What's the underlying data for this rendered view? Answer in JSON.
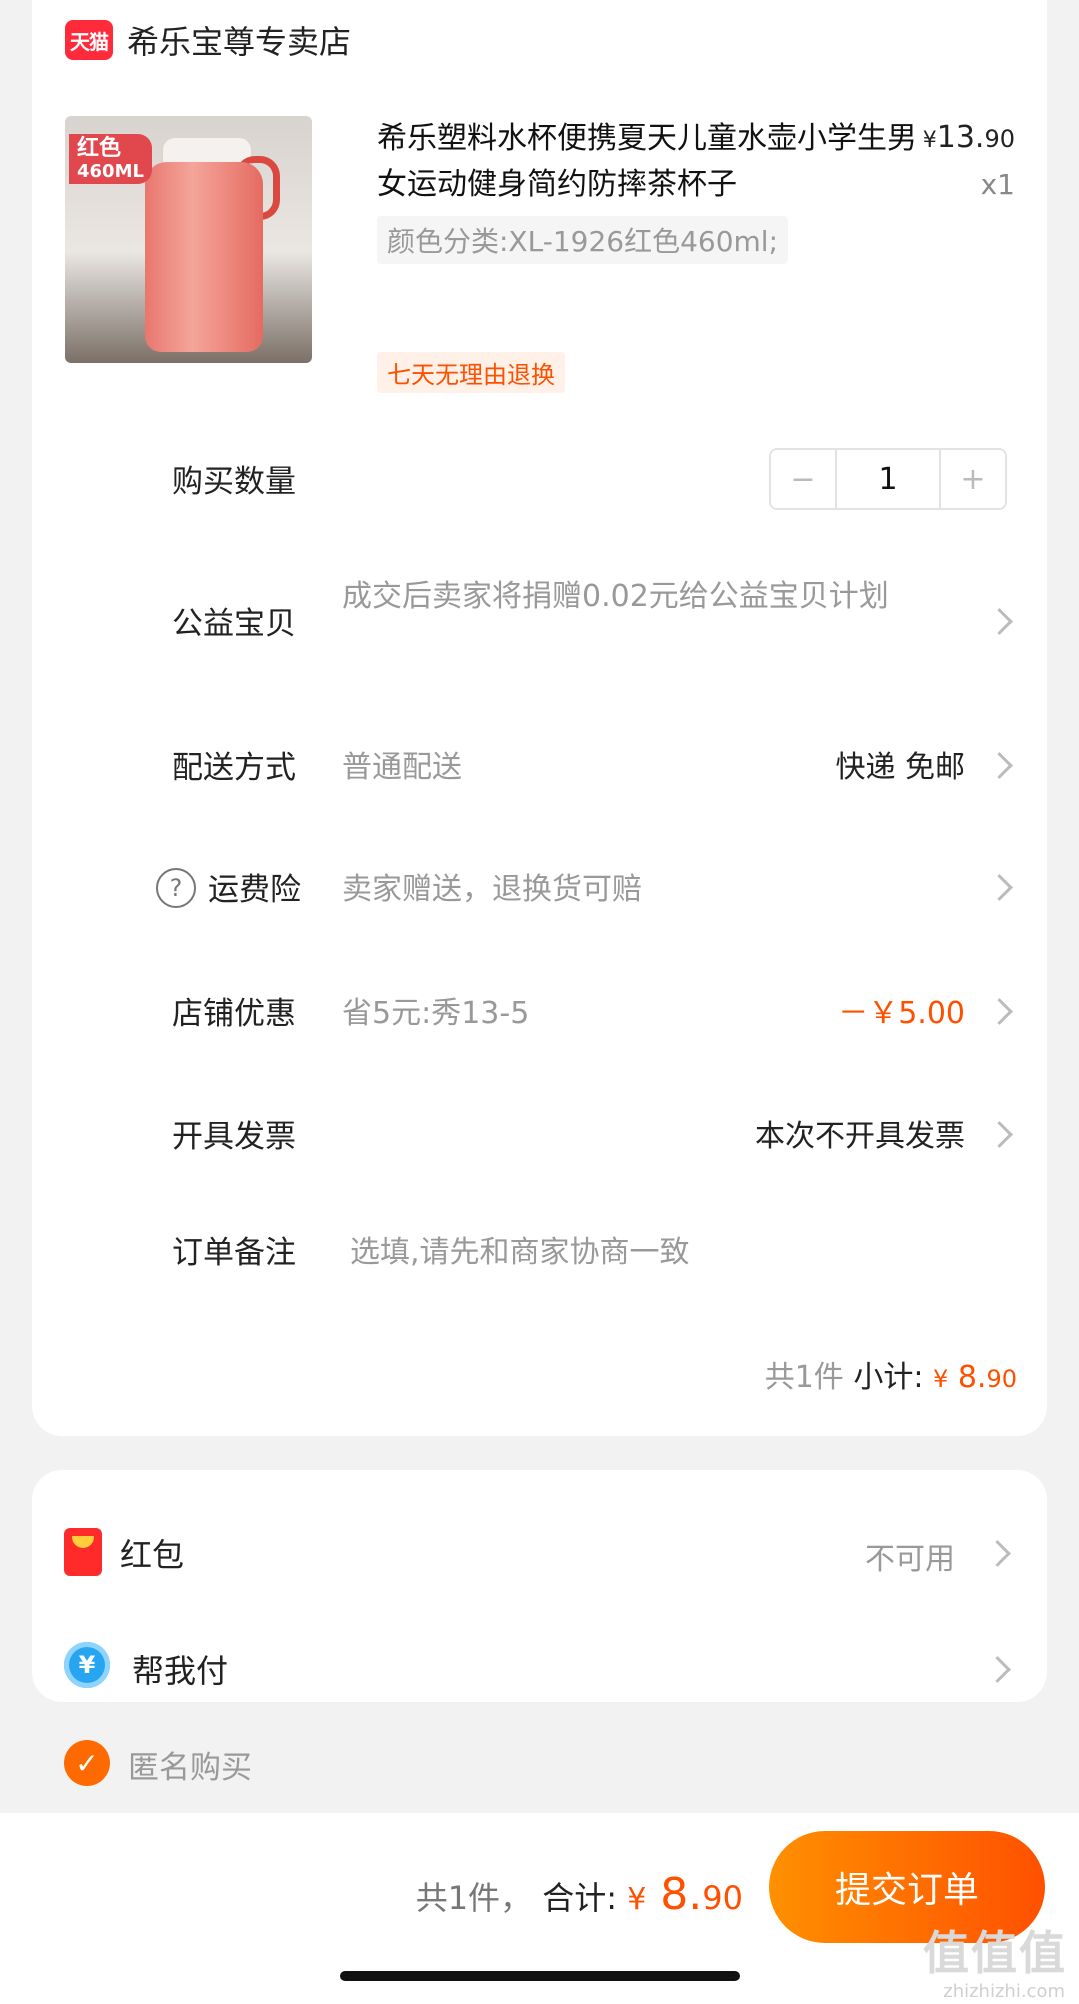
{
  "store": {
    "logo_text": "天猫",
    "name": "希乐宝尊专卖店"
  },
  "product": {
    "image_tag_color": "红色",
    "image_tag_size": "460ML",
    "title": "希乐塑料水杯便携夏天儿童水壶小学生男女运动健身简约防摔茶杯子",
    "price_yen": "¥",
    "price_int": "13.",
    "price_dec": "90",
    "quantity_x": "x1",
    "spec": "颜色分类:XL-1926红色460ml;",
    "badge": "七天无理由退换"
  },
  "rows": {
    "qty": {
      "label": "购买数量",
      "minus": "−",
      "value": "1",
      "plus": "+"
    },
    "charity": {
      "label": "公益宝贝",
      "value": "成交后卖家将捐赠0.02元给公益宝贝计划"
    },
    "delivery": {
      "label": "配送方式",
      "value": "普通配送",
      "right": "快递 免邮"
    },
    "insurance": {
      "icon": "?",
      "label": "运费险",
      "value": "卖家赠送，退换货可赔"
    },
    "store_discount": {
      "label": "店铺优惠",
      "value": "省5元:秀13-5",
      "right": "－￥5.00"
    },
    "invoice": {
      "label": "开具发票",
      "right": "本次不开具发票"
    },
    "remark": {
      "label": "订单备注",
      "placeholder": "选填,请先和商家协商一致"
    }
  },
  "subtotal": {
    "count": "共1件",
    "label": "小计:",
    "yen": "¥",
    "int": "8.",
    "dec": "90"
  },
  "payment": {
    "redpacket": {
      "label": "红包",
      "right": "不可用"
    },
    "helppay": {
      "icon": "¥",
      "label": "帮我付"
    }
  },
  "anonymous": {
    "label": "匿名购买",
    "checked": true
  },
  "bottom": {
    "count": "共1件，",
    "label": "合计:",
    "yen": "¥",
    "int": "8.",
    "dec": "90",
    "submit": "提交订单",
    "watermark": "值值值",
    "watermark_sub": "zhizhizhi.com"
  },
  "colors": {
    "accent": "#ff5000",
    "tmall": "#ff2a3a"
  }
}
